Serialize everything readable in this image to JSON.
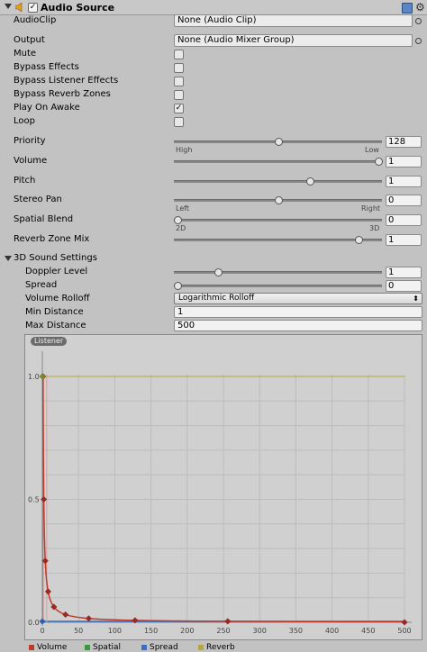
{
  "header": {
    "title": "Audio Source",
    "enabled_mark": "✓"
  },
  "fields": {
    "audio_clip": {
      "label": "AudioClip",
      "value": "None (Audio Clip)"
    },
    "output": {
      "label": "Output",
      "value": "None (Audio Mixer Group)"
    }
  },
  "checks": {
    "mute": {
      "label": "Mute",
      "checked": false
    },
    "bypass_effects": {
      "label": "Bypass Effects",
      "checked": false
    },
    "bypass_listener_effects": {
      "label": "Bypass Listener Effects",
      "checked": false
    },
    "bypass_reverb_zones": {
      "label": "Bypass Reverb Zones",
      "checked": false
    },
    "play_on_awake": {
      "label": "Play On Awake",
      "checked": true,
      "mark": "✓"
    },
    "loop": {
      "label": "Loop",
      "checked": false
    }
  },
  "sliders": {
    "priority": {
      "label": "Priority",
      "value": "128",
      "fraction": 0.5,
      "left_hint": "High",
      "right_hint": "Low"
    },
    "volume": {
      "label": "Volume",
      "value": "1",
      "fraction": 1.0
    },
    "pitch": {
      "label": "Pitch",
      "value": "1",
      "fraction": 0.66
    },
    "stereo_pan": {
      "label": "Stereo Pan",
      "value": "0",
      "fraction": 0.5,
      "left_hint": "Left",
      "right_hint": "Right"
    },
    "spatial_blend": {
      "label": "Spatial Blend",
      "value": "0",
      "fraction": 0.0,
      "left_hint": "2D",
      "right_hint": "3D"
    },
    "reverb_zone_mix": {
      "label": "Reverb Zone Mix",
      "value": "1",
      "fraction": 0.9
    }
  },
  "sound3d": {
    "section_label": "3D Sound Settings",
    "doppler": {
      "label": "Doppler Level",
      "value": "1",
      "fraction": 0.2
    },
    "spread": {
      "label": "Spread",
      "value": "0",
      "fraction": 0.0
    },
    "rolloff": {
      "label": "Volume Rolloff",
      "value": "Logarithmic Rolloff"
    },
    "min_distance": {
      "label": "Min Distance",
      "value": "1"
    },
    "max_distance": {
      "label": "Max Distance",
      "value": "500"
    }
  },
  "graph": {
    "listener_label": "Listener",
    "y_ticks": [
      "1.0",
      "0.5",
      "0.0"
    ],
    "x_ticks": [
      "0",
      "50",
      "100",
      "150",
      "200",
      "250",
      "300",
      "350",
      "400",
      "450",
      "500"
    ],
    "legend": [
      {
        "label": "Volume",
        "color": "#c03a2b"
      },
      {
        "label": "Spatial",
        "color": "#3a9a3a"
      },
      {
        "label": "Spread",
        "color": "#3b6fc6"
      },
      {
        "label": "Reverb",
        "color": "#b8a63a"
      }
    ]
  }
}
